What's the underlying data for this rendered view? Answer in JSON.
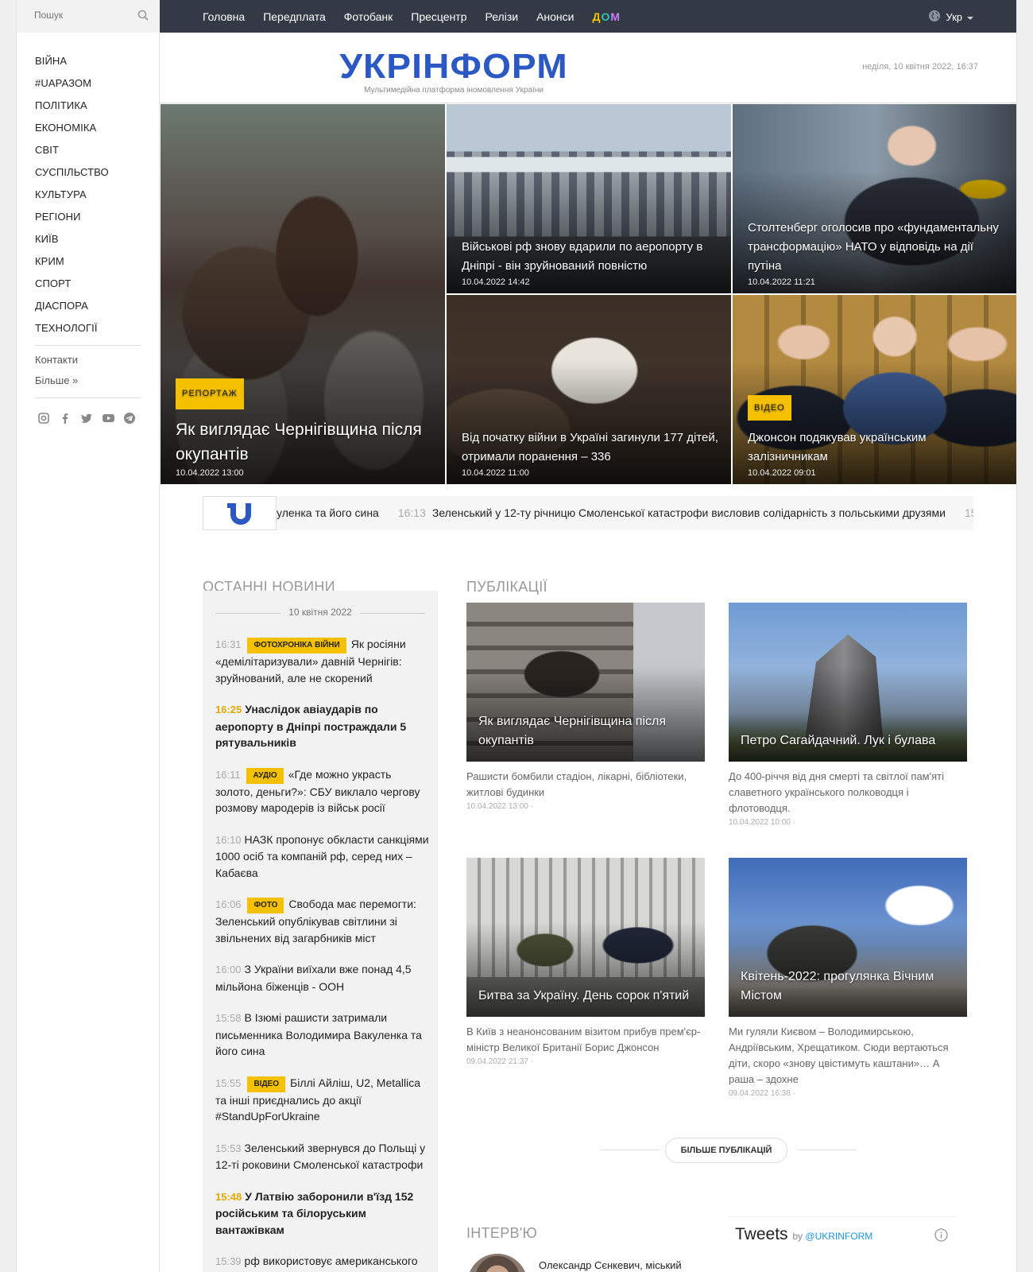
{
  "search": {
    "placeholder": "Пошук"
  },
  "sidebar": {
    "nav": [
      "ВІЙНА",
      "#UAРАЗОМ",
      "ПОЛІТИКА",
      "ЕКОНОМІКА",
      "СВІТ",
      "СУСПІЛЬСТВО",
      "КУЛЬТУРА",
      "РЕГІОНИ",
      "КИЇВ",
      "КРИМ",
      "СПОРТ",
      "ДІАСПОРА",
      "ТЕХНОЛОГІЇ"
    ],
    "contacts": "Контакти",
    "more": "Більше »",
    "socials": [
      "instagram-icon",
      "facebook-icon",
      "twitter-icon",
      "youtube-icon",
      "telegram-icon"
    ]
  },
  "topbar": {
    "links": [
      "Головна",
      "Передплата",
      "Фотобанк",
      "Пресцентр",
      "Релізи",
      "Анонси"
    ],
    "dom": "ДОМ",
    "lang": "Укр"
  },
  "header": {
    "logo": "УКРІНФОРМ",
    "tagline": "Мультимедійна платформа іномовлення України",
    "date": "неділя, 10 квітня 2022, 16:37"
  },
  "hero": {
    "big": {
      "badge": "РЕПОРТАЖ",
      "title": "Як виглядає Чернігівщина після окупантів",
      "time": "10.04.2022 13:00"
    },
    "tiles": [
      {
        "title": "Військові рф знову вдарили по аеропорту в Дніпрі - він зруйнований повністю",
        "time": "10.04.2022 14:42"
      },
      {
        "title": "Столтенберг оголосив про «фундаментальну трансформацію» НАТО у відповідь на дії путіна",
        "time": "10.04.2022 11:21"
      },
      {
        "title": "Від початку війни в Україні загинули 177 дітей, отримали поранення – 336",
        "time": "10.04.2022 11:00"
      },
      {
        "badge": "ВІДЕО",
        "title": "Джонсон подякував українським залізничникам",
        "time": "10.04.2022 09:01"
      }
    ]
  },
  "ticker": {
    "lead": "уленка та його сина",
    "time": "16:13",
    "text": "Зеленський у 12-ту річницю Смоленської катастрофи висловив солідарність з польськими друзями",
    "next_time": "15"
  },
  "latest": {
    "title": "ОСТАННІ НОВИНИ",
    "date": "10 квітня 2022",
    "items": [
      {
        "time": "16:31",
        "tag": "ФОТОХРОНІКА ВІЙНИ",
        "text": "Як росіяни «демілітаризували» давній Чернігів: зруйнований, але не скорений",
        "bold": false
      },
      {
        "time": "16:25",
        "tag": "",
        "text": "Унаслідок авіаударів по аеропорту в Дніпрі постраждали 5 рятувальників",
        "bold": true
      },
      {
        "time": "16:11",
        "tag": "АУДІО",
        "text": "«Где можно украсть золото, деньги?»: СБУ виклало чергову розмову мародерів із військ росії",
        "bold": false
      },
      {
        "time": "16:10",
        "tag": "",
        "text": "НАЗК пропонує обкласти санкціями 1000 осіб та компаній рф, серед них – Кабаєва",
        "bold": false
      },
      {
        "time": "16:06",
        "tag": "ФОТО",
        "text": "Свобода має перемогти: Зеленський опублікував світлини зі звільнених від загарбників міст",
        "bold": false
      },
      {
        "time": "16:00",
        "tag": "",
        "text": "З України виїхали вже понад 4,5 мільйона біженців - ООН",
        "bold": false
      },
      {
        "time": "15:58",
        "tag": "",
        "text": "В Ізюмі рашисти затримали письменника Володимира Вакуленка та його сина",
        "bold": false
      },
      {
        "time": "15:55",
        "tag": "ВІДЕО",
        "text": "Біллі Айліш, U2, Metallica та інші приєднались до акції #StandUpForUkraine",
        "bold": false
      },
      {
        "time": "15:53",
        "tag": "",
        "text": "Зеленський звернувся до Польщі у 12-ті роковини Смоленської катастрофи",
        "bold": false
      },
      {
        "time": "15:48",
        "tag": "",
        "text": "У Латвію заборонили в'їзд 152 російським та білоруським вантажівкам",
        "bold": true
      },
      {
        "time": "15:39",
        "tag": "",
        "text": "рф використовує американського",
        "bold": false
      }
    ]
  },
  "publications": {
    "title": "ПУБЛІКАЦІЇ",
    "items": [
      {
        "title": "Як виглядає Чернігівщина після окупантів",
        "desc": "Рашисти бомбили стадіон, лікарні, бібліотеки, житлові будинки",
        "date": "10.04.2022 13:00 ·"
      },
      {
        "title": "Петро Сагайдачний. Лук і булава",
        "desc": "До 400-річчя від дня смерті та світлої пам'яті славетного українського полководця і флотоводця.",
        "date": "10.04.2022 10:00 ·"
      },
      {
        "title": "Битва за Україну. День сорок п'ятий",
        "desc": "В Київ з неанонсованим візитом прибув прем'єр-міністр Великої Британії Борис Джонсон",
        "date": "09.04.2022 21:37 ·"
      },
      {
        "title": "Квітень-2022: прогулянка Вічним Містом",
        "desc": "Ми гуляли Києвом – Володимирською, Андріївським, Хрещатиком. Сюди вертаються діти, скоро «знову цвістимуть каштани»… А раша – здохне",
        "date": "09.04.2022 16:38 ·"
      }
    ],
    "more": "БІЛЬШЕ ПУБЛІКАЦІЙ"
  },
  "interview": {
    "title": "ІНТЕРВ'Ю",
    "item": "Олександр Сєнкевич, міський"
  },
  "tweets": {
    "title": "Tweets",
    "by": "by",
    "handle": "@UKRINFORM"
  },
  "colors": {
    "accent": "#f5c000",
    "brand": "#2b58c2",
    "topbar": "#333a46"
  }
}
